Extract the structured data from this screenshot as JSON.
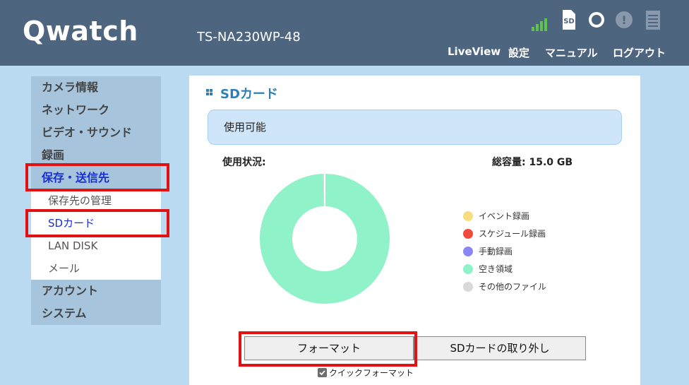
{
  "header": {
    "logo": "Qwatch",
    "model": "TS-NA230WP-48",
    "status_icons": [
      "signal-strength-icon",
      "sd-card-icon",
      "recording-status-icon",
      "alert-icon",
      "document-icon"
    ],
    "sd_icon_text": "SD",
    "alert_icon_text": "!",
    "nav": {
      "liveview": "LiveView",
      "settings": "設定",
      "manual": "マニュアル",
      "logout": "ログアウト"
    }
  },
  "sidebar": {
    "items": [
      {
        "label": "カメラ情報"
      },
      {
        "label": "ネットワーク"
      },
      {
        "label": "ビデオ・サウンド"
      },
      {
        "label": "録画"
      },
      {
        "label": "保存・送信先"
      },
      {
        "label": "保存先の管理"
      },
      {
        "label": "SDカード"
      },
      {
        "label": "LAN DISK"
      },
      {
        "label": "メール"
      },
      {
        "label": "アカウント"
      },
      {
        "label": "システム"
      }
    ]
  },
  "main": {
    "title": "SDカード",
    "status": "使用可能",
    "usage_label": "使用状況:",
    "capacity": "総容量: 15.0 GB",
    "legend": [
      {
        "label": "イベント録画",
        "color": "#f7dd7e"
      },
      {
        "label": "スケジュール録画",
        "color": "#f04b3c"
      },
      {
        "label": "手動録画",
        "color": "#8b86f6"
      },
      {
        "label": "空き領域",
        "color": "#90f2c8"
      },
      {
        "label": "その他のファイル",
        "color": "#d9d9d9"
      }
    ],
    "format_button": "フォーマット",
    "remove_button": "SDカードの取り外し",
    "quick_format_label": "クイックフォーマット",
    "quick_format_checked": true
  },
  "chart_data": {
    "type": "pie",
    "categories": [
      "イベント録画",
      "スケジュール録画",
      "手動録画",
      "空き領域",
      "その他のファイル"
    ],
    "values": [
      0,
      0,
      0,
      99.6,
      0.4
    ],
    "colors": [
      "#f7dd7e",
      "#f04b3c",
      "#8b86f6",
      "#90f2c8",
      "#d9d9d9"
    ],
    "title": "",
    "donut": true,
    "legend_position": "right"
  },
  "colors": {
    "header_bg": "#4e6580",
    "page_bg": "#b9daf0",
    "accent": "#2e7fb5",
    "active_link": "#1a2fd0",
    "highlight_box": "#e31212"
  }
}
